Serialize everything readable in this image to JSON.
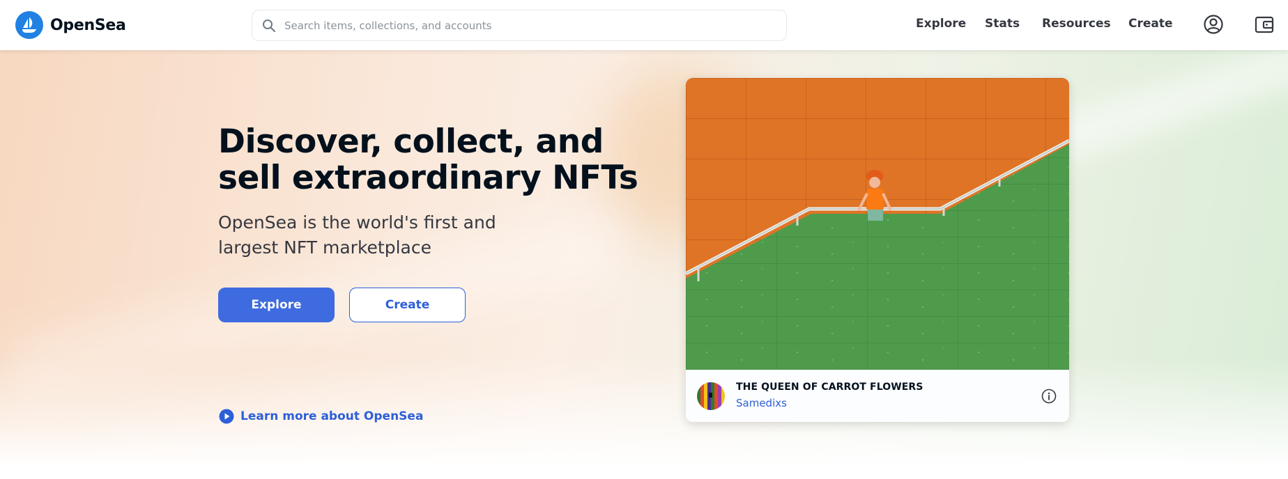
{
  "header": {
    "brand": "OpenSea",
    "search_placeholder": "Search items, collections, and accounts",
    "nav": [
      "Explore",
      "Stats",
      "Resources",
      "Create"
    ],
    "icons": [
      "opensea-logo-icon",
      "search-icon",
      "account-icon",
      "wallet-icon"
    ]
  },
  "hero": {
    "title": "Discover, collect, and sell extraordinary NFTs",
    "subtitle": "OpenSea is the world's first and largest NFT marketplace",
    "primary_button": "Explore",
    "secondary_button": "Create",
    "learn_more": "Learn more about OpenSea"
  },
  "featured": {
    "title": "THE QUEEN OF CARROT FLOWERS",
    "creator": "Samedixs",
    "icons": [
      "info-icon"
    ]
  },
  "colors": {
    "brand": "#2081e2",
    "primary_button": "#3e6be0",
    "link": "#2d5fd8",
    "wall_orange": "#df7324",
    "wall_green": "#4e9a4b"
  }
}
